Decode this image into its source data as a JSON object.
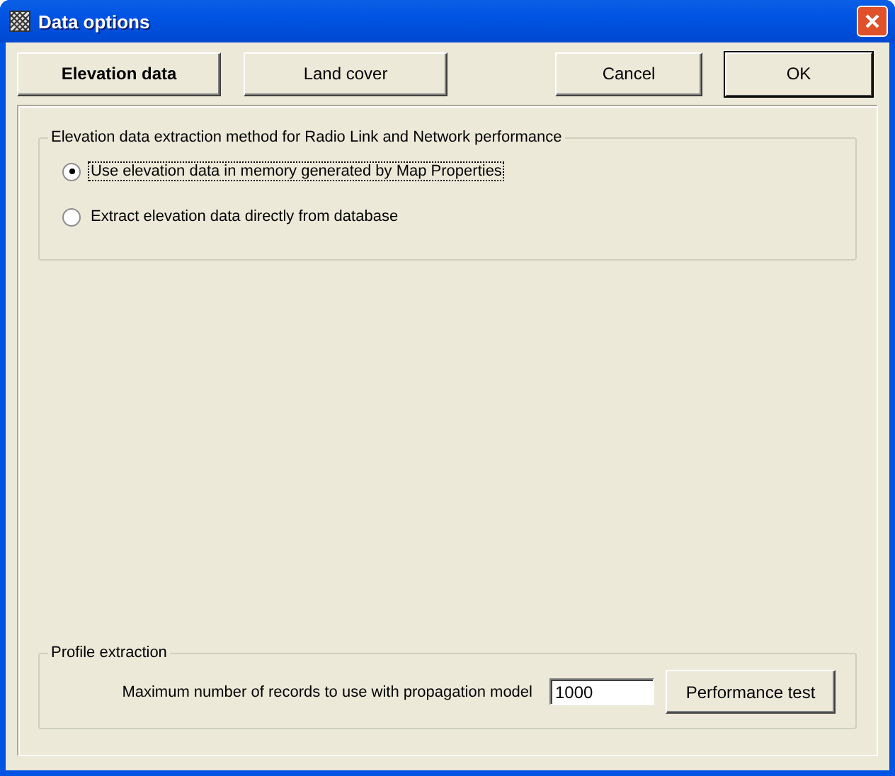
{
  "window": {
    "title": "Data options"
  },
  "tabs": [
    {
      "label": "Elevation data",
      "selected": true
    },
    {
      "label": "Land cover",
      "selected": false
    }
  ],
  "buttons": [
    {
      "label": "Cancel",
      "default": false
    },
    {
      "label": "OK",
      "default": true
    }
  ],
  "elevation_group": {
    "title": "Elevation data extraction method for Radio Link and Network performance",
    "options": [
      {
        "label": "Use elevation data in memory generated by Map Properties",
        "selected": true,
        "focused": true
      },
      {
        "label": "Extract elevation data directly from database",
        "selected": false,
        "focused": false
      }
    ]
  },
  "profile_group": {
    "title": "Profile extraction",
    "label": "Maximum number of records to use with propagation model",
    "value": "1000",
    "button": "Performance test"
  }
}
